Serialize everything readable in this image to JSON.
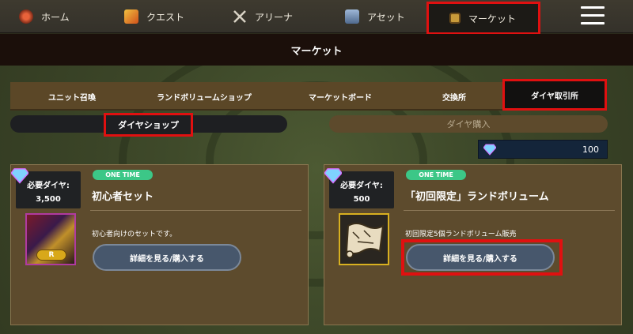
{
  "nav": {
    "items": [
      {
        "label": "ホーム",
        "icon": "home-icon"
      },
      {
        "label": "クエスト",
        "icon": "quest-icon"
      },
      {
        "label": "アリーナ",
        "icon": "arena-icon"
      },
      {
        "label": "アセット",
        "icon": "asset-icon"
      },
      {
        "label": "マーケット",
        "icon": "market-icon"
      }
    ],
    "menu_icon": "hamburger-menu-icon"
  },
  "page_title": "マーケット",
  "tabs": [
    "ユニット召喚",
    "ランドボリュームショップ",
    "マーケットボード",
    "交換所",
    "ダイヤ取引所"
  ],
  "subtabs": {
    "left": "ダイヤショップ",
    "right": "ダイヤ購入"
  },
  "balance": {
    "value": "100",
    "icon": "diamond-icon"
  },
  "cards": [
    {
      "cost_label": "必要ダイヤ:",
      "cost_value": "3,500",
      "badge": "ONE TIME",
      "title": "初心者セット",
      "description": "初心者向けのセットです。",
      "thumb_badge": "R",
      "button": "詳細を見る/購入する"
    },
    {
      "cost_label": "必要ダイヤ:",
      "cost_value": "500",
      "badge": "ONE TIME",
      "title": "「初回限定」ランドボリューム",
      "description": "初回限定5個ランドボリューム販売",
      "button": "詳細を見る/購入する"
    }
  ],
  "colors": {
    "highlight": "#e01010",
    "badge": "#3cc787",
    "button": "#47576c"
  }
}
